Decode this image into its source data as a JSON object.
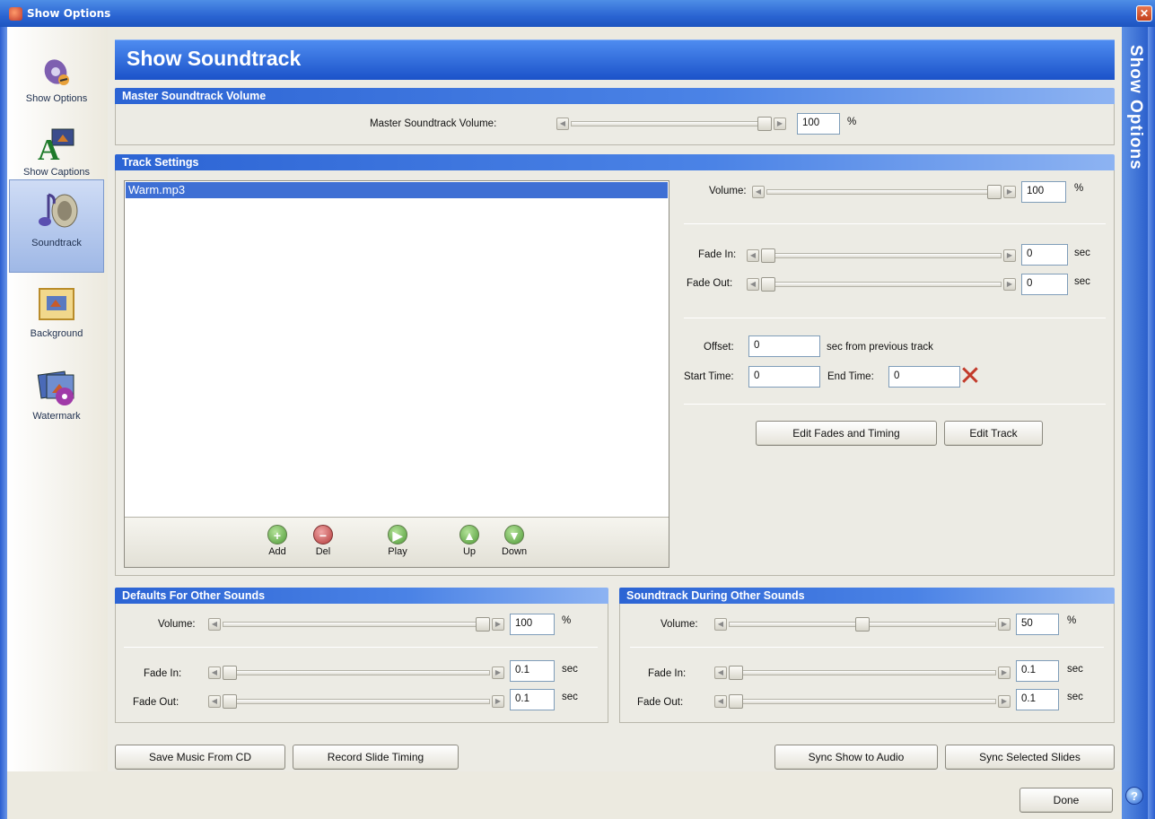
{
  "window": {
    "title": "Show Options"
  },
  "sidebar": {
    "items": [
      {
        "label": "Show Options",
        "icon": "show-options-icon"
      },
      {
        "label": "Show Captions",
        "icon": "captions-icon"
      },
      {
        "label": "Soundtrack",
        "icon": "soundtrack-icon",
        "selected": true
      },
      {
        "label": "Background",
        "icon": "background-icon"
      },
      {
        "label": "Watermark",
        "icon": "watermark-icon"
      }
    ]
  },
  "header": {
    "title": "Show Soundtrack"
  },
  "side_title": "Show Options",
  "master": {
    "section": "Master Soundtrack Volume",
    "label": "Master Soundtrack Volume:",
    "value": "100",
    "unit": "%",
    "level": 1.0
  },
  "track": {
    "section": "Track Settings",
    "tracks": [
      "Warm.mp3"
    ],
    "buttons": {
      "add": "Add",
      "del": "Del",
      "play": "Play",
      "up": "Up",
      "down": "Down"
    },
    "volume": {
      "label": "Volume:",
      "value": "100",
      "unit": "%",
      "level": 1.0
    },
    "fade_in": {
      "label": "Fade In:",
      "value": "0",
      "unit": "sec",
      "level": 0.0
    },
    "fade_out": {
      "label": "Fade Out:",
      "value": "0",
      "unit": "sec",
      "level": 0.0
    },
    "offset": {
      "label": "Offset:",
      "value": "0",
      "suffix": "sec from previous track"
    },
    "start_time": {
      "label": "Start Time:",
      "value": "0"
    },
    "end_time": {
      "label": "End Time:",
      "value": "0"
    },
    "edit_fades": "Edit Fades and Timing",
    "edit_track": "Edit Track"
  },
  "defaults": {
    "section": "Defaults For Other Sounds",
    "volume": {
      "label": "Volume:",
      "value": "100",
      "unit": "%",
      "level": 1.0
    },
    "fade_in": {
      "label": "Fade In:",
      "value": "0.1",
      "unit": "sec",
      "level": 0.0
    },
    "fade_out": {
      "label": "Fade Out:",
      "value": "0.1",
      "unit": "sec",
      "level": 0.0
    }
  },
  "during": {
    "section": "Soundtrack During Other Sounds",
    "volume": {
      "label": "Volume:",
      "value": "50",
      "unit": "%",
      "level": 0.5
    },
    "fade_in": {
      "label": "Fade In:",
      "value": "0.1",
      "unit": "sec",
      "level": 0.0
    },
    "fade_out": {
      "label": "Fade Out:",
      "value": "0.1",
      "unit": "sec",
      "level": 0.0
    }
  },
  "footer": {
    "save_music": "Save Music From CD",
    "record_timing": "Record Slide Timing",
    "sync_show": "Sync Show to Audio",
    "sync_selected": "Sync Selected Slides",
    "done": "Done"
  },
  "colors": {
    "accent": "#2c64d4",
    "selected_track": "#3e6fd4"
  }
}
